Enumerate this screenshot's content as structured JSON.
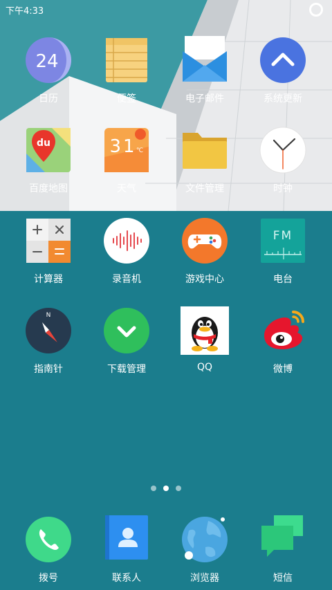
{
  "status_bar": {
    "time": "下午4:33"
  },
  "apps": [
    {
      "id": "calendar",
      "label": "日历",
      "badge": "24"
    },
    {
      "id": "notes",
      "label": "便签"
    },
    {
      "id": "email",
      "label": "电子邮件"
    },
    {
      "id": "system-update",
      "label": "系统更新"
    },
    {
      "id": "baidu-map",
      "label": "百度地图",
      "badge": "du"
    },
    {
      "id": "weather",
      "label": "天气",
      "badge": "31",
      "unit": "℃"
    },
    {
      "id": "file-manager",
      "label": "文件管理"
    },
    {
      "id": "clock",
      "label": "时钟"
    },
    {
      "id": "calculator",
      "label": "计算器"
    },
    {
      "id": "recorder",
      "label": "录音机"
    },
    {
      "id": "game-center",
      "label": "游戏中心"
    },
    {
      "id": "radio",
      "label": "电台",
      "badge": "FM"
    },
    {
      "id": "compass",
      "label": "指南针",
      "badge": "N"
    },
    {
      "id": "download-manager",
      "label": "下载管理"
    },
    {
      "id": "qq",
      "label": "QQ"
    },
    {
      "id": "weibo",
      "label": "微博"
    }
  ],
  "page_indicator": {
    "total": 3,
    "active": 2
  },
  "dock": [
    {
      "id": "phone",
      "label": "拨号"
    },
    {
      "id": "contacts",
      "label": "联系人"
    },
    {
      "id": "browser",
      "label": "浏览器"
    },
    {
      "id": "messages",
      "label": "短信"
    }
  ]
}
